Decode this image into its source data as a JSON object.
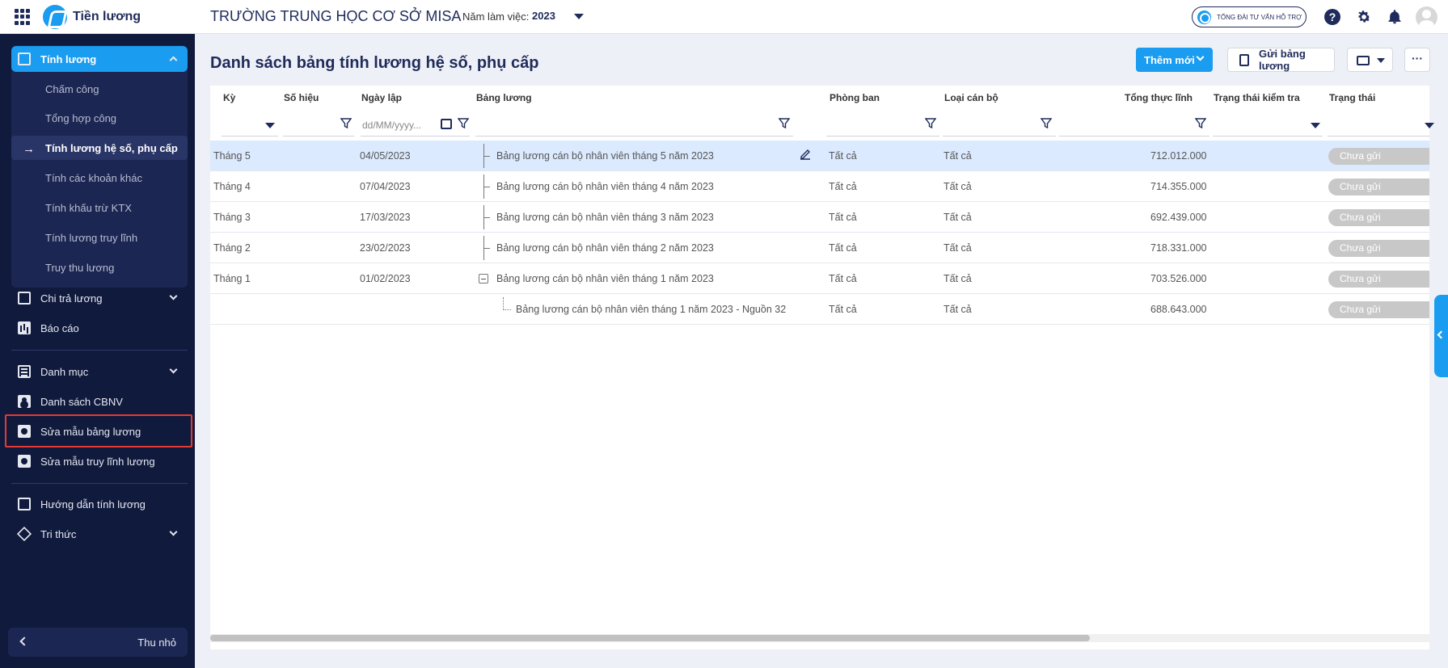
{
  "header": {
    "app_name": "Tiền lương",
    "school_name": "TRƯỜNG TRUNG HỌC CƠ SỞ MISA",
    "year_label": "Năm làm việc:",
    "year_value": "2023",
    "support_label": "TỔNG ĐÀI TƯ VẤN HỖ TRỢ",
    "help_glyph": "?"
  },
  "sidebar": {
    "main_item": "Tính lương",
    "sub_items": [
      "Chấm công",
      "Tổng hợp công",
      "Tính lương hệ số, phụ cấp",
      "Tính các khoản khác",
      "Tính khấu trừ KTX",
      "Tính lương truy lĩnh",
      "Truy thu lương"
    ],
    "active_sub_arrow": "→",
    "items": [
      "Chi trả lương",
      "Báo cáo",
      "Danh mục",
      "Danh sách CBNV",
      "Sửa mẫu bảng lương",
      "Sửa mẫu truy lĩnh lương",
      "Hướng dẫn tính lương",
      "Tri thức"
    ],
    "collapse_label": "Thu nhỏ"
  },
  "page": {
    "title": "Danh sách bảng tính lương hệ số, phụ cấp",
    "add_button": "Thêm mới",
    "send_button": "Gửi bảng lương",
    "more_button": "···"
  },
  "table": {
    "columns": [
      "Kỳ",
      "Số hiệu",
      "Ngày lập",
      "Bảng lương",
      "Phòng ban",
      "Loại cán bộ",
      "Tổng thực lĩnh",
      "Trạng thái kiểm tra",
      "Trạng thái"
    ],
    "date_placeholder": "dd/MM/yyyy...",
    "rows": [
      {
        "period": "Tháng 5",
        "date": "04/05/2023",
        "name": "Bảng lương cán bộ nhân viên tháng 5 năm 2023",
        "dept": "Tất cả",
        "type": "Tất cả",
        "total": "712.012.000",
        "status": "Chưa gửi"
      },
      {
        "period": "Tháng 4",
        "date": "07/04/2023",
        "name": "Bảng lương cán bộ nhân viên tháng 4 năm 2023",
        "dept": "Tất cả",
        "type": "Tất cả",
        "total": "714.355.000",
        "status": "Chưa gửi"
      },
      {
        "period": "Tháng 3",
        "date": "17/03/2023",
        "name": "Bảng lương cán bộ nhân viên tháng 3 năm 2023",
        "dept": "Tất cả",
        "type": "Tất cả",
        "total": "692.439.000",
        "status": "Chưa gửi"
      },
      {
        "period": "Tháng 2",
        "date": "23/02/2023",
        "name": "Bảng lương cán bộ nhân viên tháng 2 năm 2023",
        "dept": "Tất cả",
        "type": "Tất cả",
        "total": "718.331.000",
        "status": "Chưa gửi"
      },
      {
        "period": "Tháng 1",
        "date": "01/02/2023",
        "name": "Bảng lương cán bộ nhân viên tháng 1 năm 2023",
        "dept": "Tất cả",
        "type": "Tất cả",
        "total": "703.526.000",
        "status": "Chưa gửi"
      },
      {
        "period": "",
        "date": "",
        "name": "Bảng lương cán bộ nhân viên tháng 1 năm 2023 - Nguồn 32",
        "dept": "Tất cả",
        "type": "Tất cả",
        "total": "688.643.000",
        "status": "Chưa gửi"
      }
    ]
  },
  "colors": {
    "sidebar_bg": "#101a3d",
    "accent": "#1a9cf0",
    "selected_row": "#dceaff",
    "badge_gray": "#c8c8c8",
    "highlight_red": "#e53935"
  }
}
